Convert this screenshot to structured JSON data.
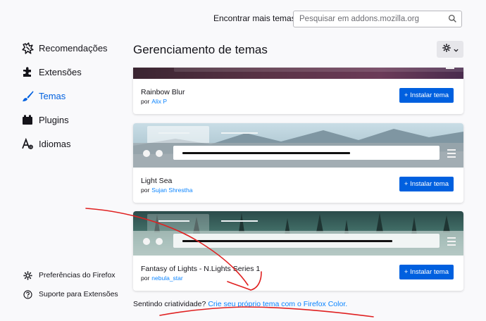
{
  "header": {
    "find_label": "Encontrar mais temas",
    "search_placeholder": "Pesquisar em addons.mozilla.org"
  },
  "sidebar": {
    "items": [
      {
        "label": "Recomendações",
        "icon": "recommendations-icon"
      },
      {
        "label": "Extensões",
        "icon": "puzzle-piece-icon"
      },
      {
        "label": "Temas",
        "icon": "brush-icon",
        "active": true
      },
      {
        "label": "Plugins",
        "icon": "plugin-icon"
      },
      {
        "label": "Idiomas",
        "icon": "languages-icon"
      }
    ],
    "footer": [
      {
        "label": "Preferências do Firefox",
        "icon": "gear-icon"
      },
      {
        "label": "Suporte para Extensões",
        "icon": "help-icon"
      }
    ]
  },
  "main": {
    "title": "Gerenciamento de temas",
    "themes": [
      {
        "name": "Rainbow Blur",
        "by": "por",
        "author": "Alix P",
        "button": "+ Instalar tema"
      },
      {
        "name": "Light Sea",
        "by": "por",
        "author": "Sujan Shrestha",
        "button": "+ Instalar tema"
      },
      {
        "name": "Fantasy of Lights - N.Lights Series 1",
        "by": "por",
        "author": "nebula_star",
        "button": "+ Instalar tema"
      }
    ],
    "footer_text": "Sentindo criatividade?",
    "footer_link": "Crie seu próprio tema com o Firefox Color."
  },
  "colors": {
    "accent": "#0060df",
    "link": "#0a84ff",
    "annotation": "#e02020"
  }
}
